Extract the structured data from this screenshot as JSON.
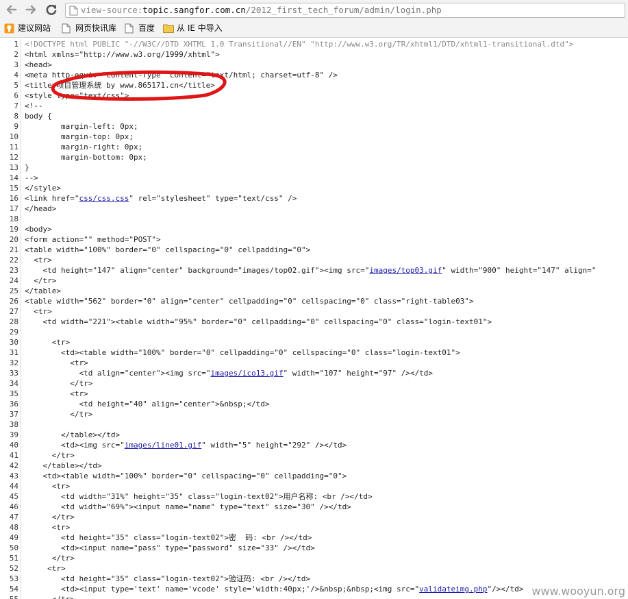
{
  "toolbar": {
    "back_icon": "back-arrow-icon",
    "forward_icon": "forward-arrow-icon",
    "reload_icon": "reload-icon",
    "url_scheme": "view-source:",
    "url_host": "topic.sangfor.com.cn",
    "url_path": "/2012_first_tech_forum/admin/login.php"
  },
  "bookmarks": [
    {
      "label": "建议网站",
      "icon": "suggested-sites-icon"
    },
    {
      "label": "网页快讯库",
      "icon": "page-icon"
    },
    {
      "label": "百度",
      "icon": "page-icon"
    },
    {
      "label": "从 IE 中导入",
      "icon": "folder-icon"
    }
  ],
  "source_lines": [
    {
      "n": "1",
      "text": "<!DOCTYPE html PUBLIC \"-//W3C//DTD XHTML 1.0 Transitional//EN\" \"http://www.w3.org/TR/xhtml1/DTD/xhtml1-transitional.dtd\">"
    },
    {
      "n": "2",
      "text": "<html xmlns=\"http://www.w3.org/1999/xhtml\">"
    },
    {
      "n": "3",
      "text": "<head>"
    },
    {
      "n": "4",
      "text": "<meta http-equiv=\"Content-Type\" content=\"text/html; charset=utf-8\" />"
    },
    {
      "n": "5",
      "text": "<title>项目管理系统 by www.865171.cn</title>"
    },
    {
      "n": "6",
      "text": "<style type=\"text/css\">"
    },
    {
      "n": "7",
      "text": "<!--"
    },
    {
      "n": "8",
      "text": "body {"
    },
    {
      "n": "9",
      "text": "        margin-left: 0px;"
    },
    {
      "n": "10",
      "text": "        margin-top: 0px;"
    },
    {
      "n": "11",
      "text": "        margin-right: 0px;"
    },
    {
      "n": "12",
      "text": "        margin-bottom: 0px;"
    },
    {
      "n": "13",
      "text": "}"
    },
    {
      "n": "14",
      "text": "-->"
    },
    {
      "n": "15",
      "text": "</style>"
    },
    {
      "n": "16",
      "pre": "<link href=\"",
      "link": "css/css.css",
      "post": "\" rel=\"stylesheet\" type=\"text/css\" />"
    },
    {
      "n": "17",
      "text": "</head>"
    },
    {
      "n": "18",
      "text": ""
    },
    {
      "n": "19",
      "text": "<body>"
    },
    {
      "n": "20",
      "text": "<form action=\"\" method=\"POST\">"
    },
    {
      "n": "21",
      "text": "<table width=\"100%\" border=\"0\" cellspacing=\"0\" cellpadding=\"0\">"
    },
    {
      "n": "22",
      "text": "  <tr>"
    },
    {
      "n": "23",
      "pre": "    <td height=\"147\" align=\"center\" background=\"images/top02.gif\"><img src=\"",
      "link": "images/top03.gif",
      "post": "\" width=\"900\" height=\"147\" align=\""
    },
    {
      "n": "24",
      "text": "  </tr>"
    },
    {
      "n": "25",
      "text": "</table>"
    },
    {
      "n": "26",
      "text": "<table width=\"562\" border=\"0\" align=\"center\" cellpadding=\"0\" cellspacing=\"0\" class=\"right-table03\">"
    },
    {
      "n": "27",
      "text": "  <tr>"
    },
    {
      "n": "28",
      "text": "    <td width=\"221\"><table width=\"95%\" border=\"0\" cellpadding=\"0\" cellspacing=\"0\" class=\"login-text01\">"
    },
    {
      "n": "29",
      "text": ""
    },
    {
      "n": "30",
      "text": "      <tr>"
    },
    {
      "n": "31",
      "text": "        <td><table width=\"100%\" border=\"0\" cellpadding=\"0\" cellspacing=\"0\" class=\"login-text01\">"
    },
    {
      "n": "32",
      "text": "          <tr>"
    },
    {
      "n": "33",
      "pre": "            <td align=\"center\"><img src=\"",
      "link": "images/ico13.gif",
      "post": "\" width=\"107\" height=\"97\" /></td>"
    },
    {
      "n": "34",
      "text": "          </tr>"
    },
    {
      "n": "35",
      "text": "          <tr>"
    },
    {
      "n": "36",
      "text": "            <td height=\"40\" align=\"center\">&nbsp;</td>"
    },
    {
      "n": "37",
      "text": "          </tr>"
    },
    {
      "n": "38",
      "text": ""
    },
    {
      "n": "39",
      "text": "        </table></td>"
    },
    {
      "n": "40",
      "pre": "        <td><img src=\"",
      "link": "images/line01.gif",
      "post": "\" width=\"5\" height=\"292\" /></td>"
    },
    {
      "n": "41",
      "text": "      </tr>"
    },
    {
      "n": "42",
      "text": "    </table></td>"
    },
    {
      "n": "43",
      "text": "    <td><table width=\"100%\" border=\"0\" cellspacing=\"0\" cellpadding=\"0\">"
    },
    {
      "n": "44",
      "text": "      <tr>"
    },
    {
      "n": "45",
      "text": "        <td width=\"31%\" height=\"35\" class=\"login-text02\">用户名称: <br /></td>"
    },
    {
      "n": "46",
      "text": "        <td width=\"69%\"><input name=\"name\" type=\"text\" size=\"30\" /></td>"
    },
    {
      "n": "47",
      "text": "      </tr>"
    },
    {
      "n": "48",
      "text": "      <tr>"
    },
    {
      "n": "49",
      "text": "        <td height=\"35\" class=\"login-text02\">密  码: <br /></td>"
    },
    {
      "n": "50",
      "text": "        <td><input name=\"pass\" type=\"password\" size=\"33\" /></td>"
    },
    {
      "n": "51",
      "text": "      </tr>"
    },
    {
      "n": "52",
      "text": "     <tr>"
    },
    {
      "n": "53",
      "text": "        <td height=\"35\" class=\"login-text02\">验证码: <br /></td>"
    },
    {
      "n": "54",
      "pre": "        <td><input type='text' name='vcode' style='width:40px;'/>&nbsp;&nbsp;<img src=\"",
      "link": "validateimg.php",
      "post": "\"/></td>"
    },
    {
      "n": "55",
      "text": "      </tr>"
    }
  ],
  "annotation_color": "#e01515",
  "watermark": "www.wooyun.org"
}
